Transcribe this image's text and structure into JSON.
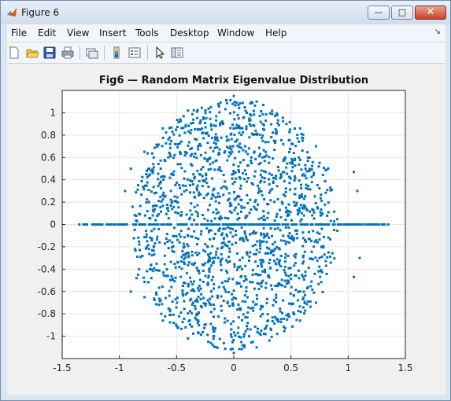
{
  "window": {
    "title": "Figure 6"
  },
  "window_controls": {
    "minimize": "—",
    "maximize": "□",
    "close": "✕"
  },
  "menu": {
    "items": [
      "File",
      "Edit",
      "View",
      "Insert",
      "Tools",
      "Desktop",
      "Window",
      "Help"
    ],
    "overflow_icon": "chevron-right-icon"
  },
  "toolbar": {
    "icons": [
      "new-figure-icon",
      "open-file-icon",
      "save-icon",
      "print-icon",
      "link-plot-icon",
      "insert-colorbar-icon",
      "insert-legend-icon",
      "pointer-icon",
      "property-editor-icon"
    ]
  },
  "colors": {
    "marker": "#0072bd",
    "axes_background": "#ffffff",
    "figure_background": "#f0f0f0",
    "grid": "#e6e6e6"
  },
  "chart_data": {
    "type": "scatter",
    "title": "Fig6 — Random Matrix Eigenvalue Distribution",
    "xlabel": "",
    "ylabel": "",
    "xlim": [
      -1.5,
      1.5
    ],
    "ylim": [
      -1.2,
      1.2
    ],
    "xticks": [
      -1.5,
      -1,
      -0.5,
      0,
      0.5,
      1,
      1.5
    ],
    "xtick_labels": [
      "-1.5",
      "-1",
      "-0.5",
      "0",
      "0.5",
      "1",
      "1.5"
    ],
    "yticks": [
      -1,
      -0.8,
      -0.6,
      -0.4,
      -0.2,
      0,
      0.2,
      0.4,
      0.6,
      0.8,
      1
    ],
    "ytick_labels": [
      "-1",
      "-0.8",
      "-0.6",
      "-0.4",
      "-0.2",
      "0",
      "0.2",
      "0.4",
      "0.6",
      "0.8",
      "1"
    ],
    "grid": true,
    "marker": "square",
    "series": [
      {
        "points": [
          [
            -0.9,
            0.5
          ],
          [
            -0.95,
            0.3
          ],
          [
            -0.85,
            -0.48
          ],
          [
            -0.9,
            -0.6
          ],
          [
            -0.78,
            0.65
          ],
          [
            -0.62,
            0.86
          ],
          [
            -0.4,
            1.02
          ],
          [
            -0.2,
            1.05
          ],
          [
            0.0,
            1.15
          ],
          [
            0.2,
            1.1
          ],
          [
            0.38,
            0.98
          ],
          [
            0.58,
            0.86
          ],
          [
            0.72,
            0.7
          ],
          [
            -0.78,
            -0.65
          ],
          [
            -0.62,
            -0.86
          ],
          [
            -0.4,
            -1.02
          ],
          [
            -0.2,
            -1.06
          ],
          [
            0.0,
            -1.15
          ],
          [
            0.2,
            -1.1
          ],
          [
            0.38,
            -0.98
          ],
          [
            0.58,
            -0.86
          ],
          [
            0.72,
            -0.7
          ],
          [
            1.05,
            0.47
          ],
          [
            1.08,
            0.3
          ],
          [
            1.1,
            -0.3
          ],
          [
            1.05,
            -0.47
          ],
          [
            -0.55,
            0.3
          ],
          [
            -0.3,
            0.45
          ],
          [
            0.1,
            0.7
          ],
          [
            0.45,
            0.6
          ],
          [
            0.6,
            0.15
          ],
          [
            -0.7,
            -0.2
          ],
          [
            -0.3,
            -0.55
          ],
          [
            0.15,
            -0.75
          ],
          [
            0.5,
            -0.45
          ],
          [
            0.75,
            -0.3
          ],
          [
            -1.35,
            0
          ],
          [
            -1.3,
            0
          ],
          [
            1.3,
            0
          ],
          [
            1.35,
            0
          ]
        ]
      }
    ]
  }
}
